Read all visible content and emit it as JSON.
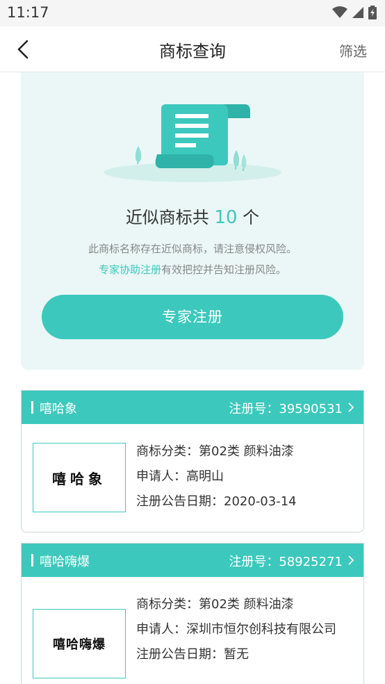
{
  "status_bar": {
    "time": "11:17"
  },
  "nav": {
    "title": "商标查询",
    "filter_label": "筛选"
  },
  "hero": {
    "headline_prefix": "近似商标共 ",
    "count": "10",
    "headline_suffix": " 个",
    "line1": "此商标名称存在近似商标，请注意侵权风险。",
    "link_text": "专家协助注册",
    "line2_rest": "有效把控并告知注册风险。",
    "cta_label": "专家注册"
  },
  "results": [
    {
      "name": "嘻哈象",
      "reg_label": "注册号：",
      "reg_no": "39590531",
      "logo_text": "嘻哈象",
      "category": "商标分类：第02类 颜料油漆",
      "applicant": "申请人：高明山",
      "date": "注册公告日期：2020-03-14"
    },
    {
      "name": "嘻哈嗨爆",
      "reg_label": "注册号：",
      "reg_no": "58925271",
      "logo_text": "嘻哈嗨爆",
      "category": "商标分类：第02类 颜料油漆",
      "applicant": "申请人：深圳市恒尔创科技有限公司",
      "date": "注册公告日期：暂无"
    }
  ],
  "colors": {
    "accent": "#3dc8bd",
    "hero_bg": "#eaf7f6"
  }
}
